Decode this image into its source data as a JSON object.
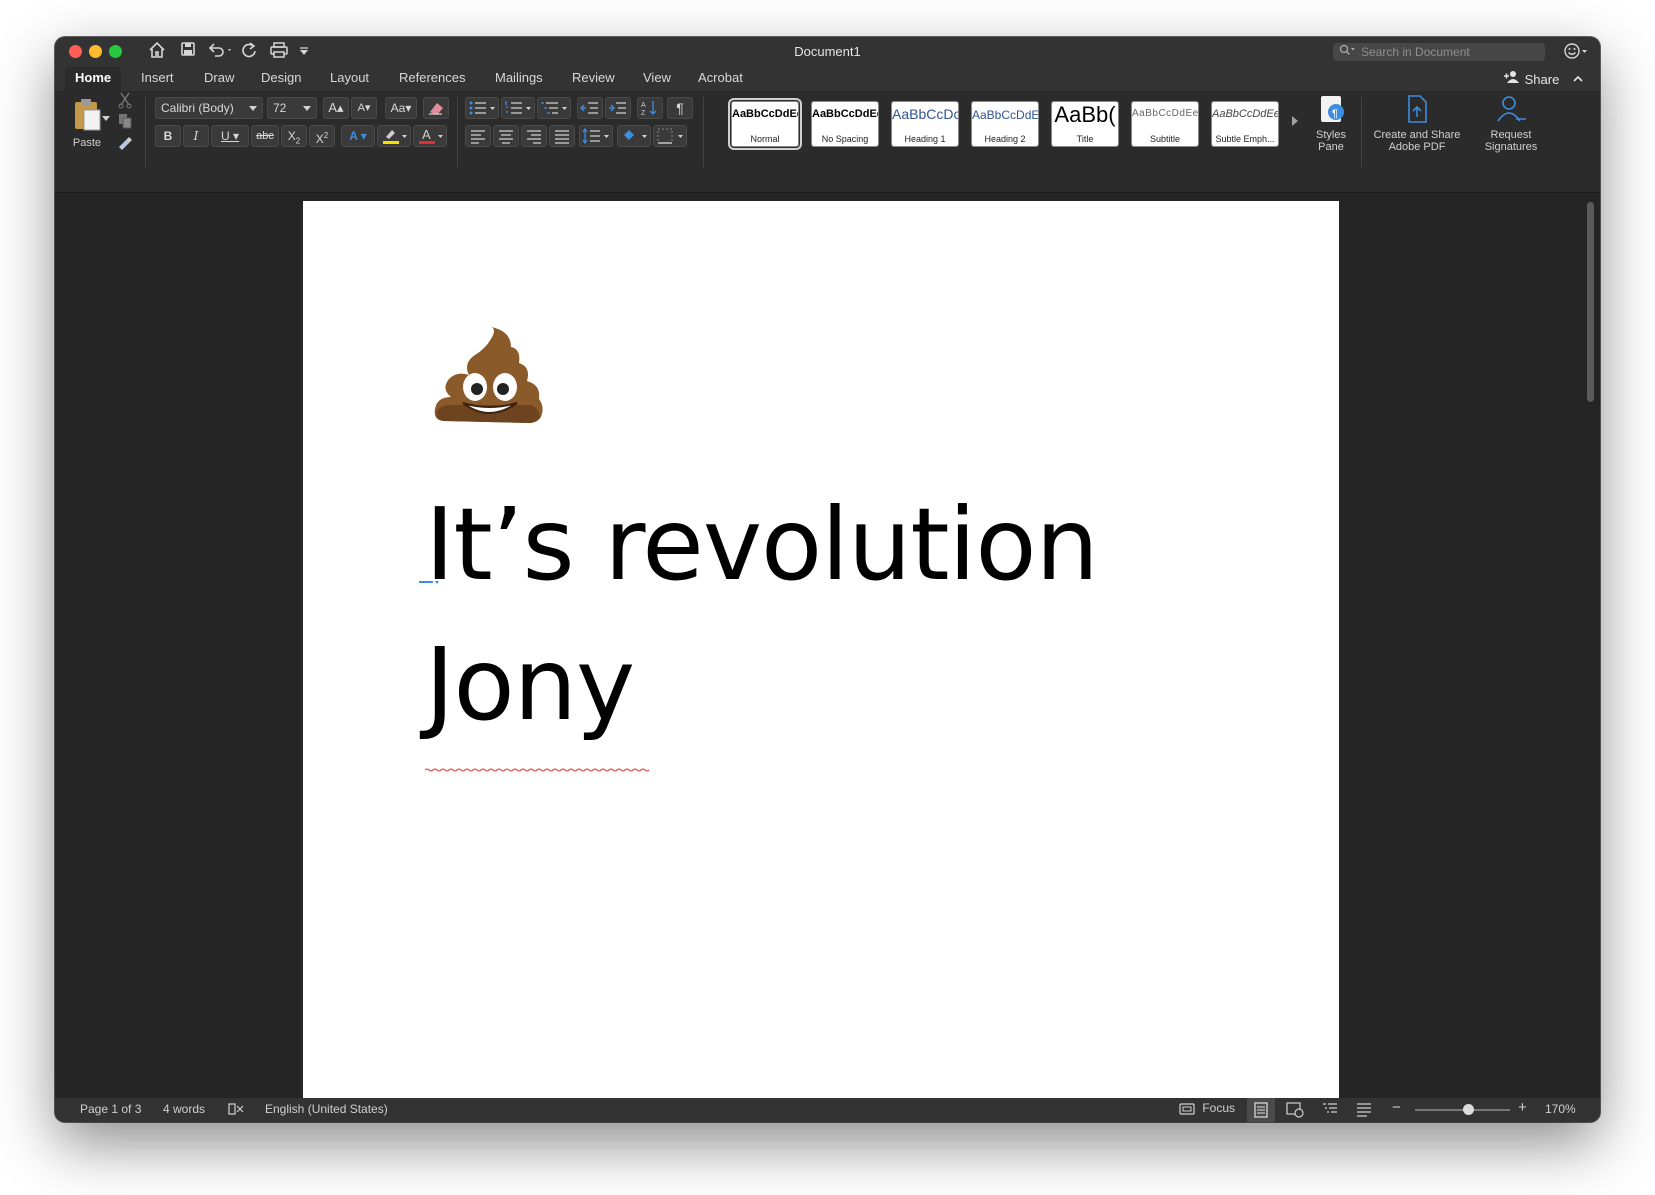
{
  "window": {
    "title": "Document1"
  },
  "search": {
    "placeholder": "Search in Document"
  },
  "tabs": [
    "Home",
    "Insert",
    "Draw",
    "Design",
    "Layout",
    "References",
    "Mailings",
    "Review",
    "View",
    "Acrobat"
  ],
  "share": {
    "label": "Share"
  },
  "ribbon": {
    "paste_label": "Paste",
    "font_name": "Calibri (Body)",
    "font_size": "72",
    "styles": [
      {
        "sample": "AaBbCcDdEe",
        "name": "Normal"
      },
      {
        "sample": "AaBbCcDdEe",
        "name": "No Spacing"
      },
      {
        "sample": "AaBbCcDc",
        "name": "Heading 1"
      },
      {
        "sample": "AaBbCcDdEe",
        "name": "Heading 2"
      },
      {
        "sample": "AaBb(",
        "name": "Title"
      },
      {
        "sample": "AaBbCcDdEe",
        "name": "Subtitle"
      },
      {
        "sample": "AaBbCcDdEe",
        "name": "Subtle Emph..."
      }
    ],
    "styles_pane_label": "Styles\nPane",
    "create_pdf_label": "Create and Share\nAdobe PDF",
    "request_sig_label": "Request\nSignatures"
  },
  "document": {
    "emoji_name": "pile-of-poo-icon",
    "line1": "It’s revolution",
    "line2": "Jony"
  },
  "status": {
    "page": "Page 1 of 3",
    "words": "4 words",
    "language": "English (United States)",
    "focus": "Focus",
    "zoom": "170%"
  },
  "colors": {
    "window_bg": "#252525",
    "titlebar": "#333333",
    "accent_blue": "#3c8de0",
    "highlight_yellow": "#f5e100",
    "font_color_red": "#e03030"
  }
}
